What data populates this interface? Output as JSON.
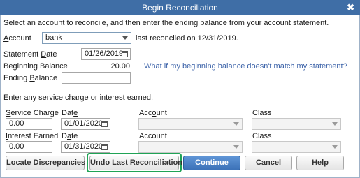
{
  "window": {
    "title": "Begin Reconciliation",
    "close_glyph": "✖"
  },
  "instructions": "Select an account to reconcile, and then enter the ending balance from your account statement.",
  "account": {
    "label": "Account",
    "value": "bank",
    "last_reconciled": "last reconciled on 12/31/2019."
  },
  "statement_date": {
    "label": "Statement Date",
    "value": "01/26/2019"
  },
  "beginning_balance": {
    "label": "Beginning Balance",
    "value": "20.00"
  },
  "ending_balance": {
    "label": "Ending Balance",
    "value": ""
  },
  "help_link": "What if my beginning balance doesn't match my statement?",
  "service_section_heading": "Enter any service charge or interest earned.",
  "service_charge": {
    "label": "Service Charge",
    "value": "0.00",
    "date_label": "Date",
    "date_value": "01/01/2020",
    "account_label": "Account",
    "account_value": "",
    "class_label": "Class",
    "class_value": ""
  },
  "interest_earned": {
    "label": "Interest Earned",
    "value": "0.00",
    "date_label": "Date",
    "date_value": "01/31/2020",
    "account_label": "Account",
    "account_value": "",
    "class_label": "Class",
    "class_value": ""
  },
  "buttons": {
    "locate": "Locate Discrepancies",
    "undo": "Undo Last Reconciliation",
    "continue": "Continue",
    "cancel": "Cancel",
    "help": "Help"
  },
  "colors": {
    "titlebar": "#3f6ea6",
    "link": "#3b62a8",
    "highlight": "#1fa355",
    "primary_button": "#3c72b8"
  }
}
